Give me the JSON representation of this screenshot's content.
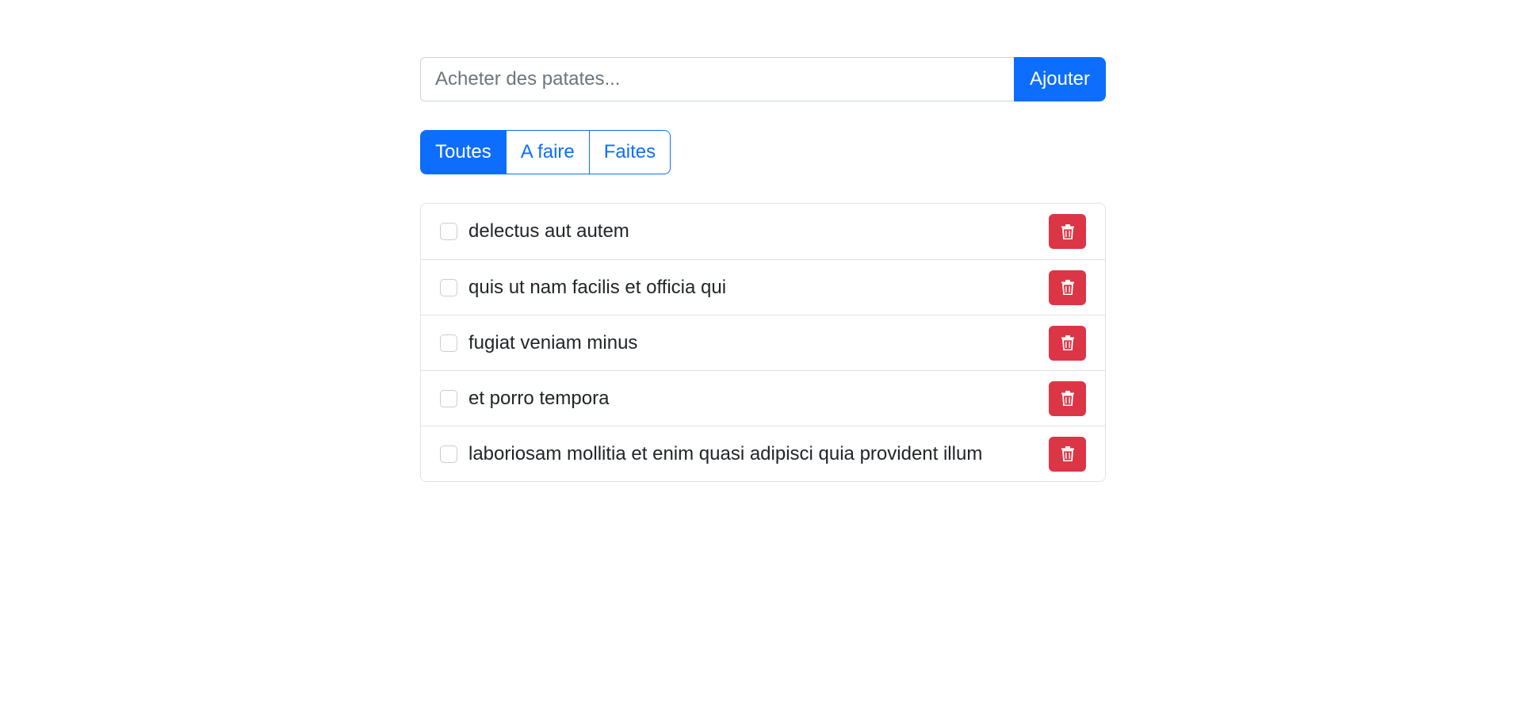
{
  "add_form": {
    "placeholder": "Acheter des patates...",
    "value": "",
    "button_label": "Ajouter",
    "accent_color": "#0d6efd"
  },
  "filters": {
    "active": "Toutes",
    "items": [
      {
        "label": "Toutes"
      },
      {
        "label": "A faire"
      },
      {
        "label": "Faites"
      }
    ]
  },
  "todos": [
    {
      "label": "delectus aut autem",
      "done": false,
      "delete_icon": "trash-icon"
    },
    {
      "label": "quis ut nam facilis et officia qui",
      "done": false,
      "delete_icon": "trash-icon"
    },
    {
      "label": "fugiat veniam minus",
      "done": false,
      "delete_icon": "trash-icon"
    },
    {
      "label": "et porro tempora",
      "done": false,
      "delete_icon": "trash-icon"
    },
    {
      "label": "laboriosam mollitia et enim quasi adipisci quia provident illum",
      "done": false,
      "delete_icon": "trash-icon"
    }
  ],
  "colors": {
    "primary": "#0d6efd",
    "danger": "#dc3545",
    "border": "#dee2e6"
  }
}
